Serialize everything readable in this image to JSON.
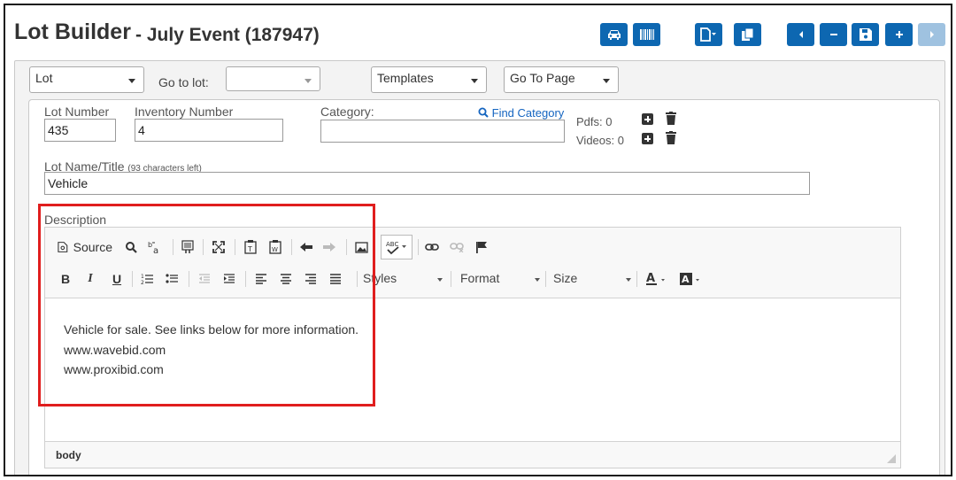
{
  "header": {
    "title": "Lot Builder",
    "subtitle": "- July Event (187947)"
  },
  "top_toolbar": {
    "buttons": [
      "car-icon",
      "barcode-icon",
      "file-dropdown-icon",
      "copy-icon",
      "prev-icon",
      "minus-icon",
      "save-icon",
      "plus-icon",
      "next-icon"
    ]
  },
  "nav": {
    "lot_select": "Lot",
    "go_to_lot_label": "Go to lot:",
    "go_to_lot_value": "",
    "templates_select": "Templates",
    "go_to_page_select": "Go To Page"
  },
  "form": {
    "lot_number_label": "Lot Number",
    "lot_number_value": "435",
    "inventory_number_label": "Inventory Number",
    "inventory_number_value": "4",
    "category_label": "Category:",
    "category_value": "",
    "find_category_label": "Find Category",
    "pdfs_label": "Pdfs: 0",
    "videos_label": "Videos: 0",
    "lot_name_label": "Lot Name/Title",
    "lot_name_hint": "(93 characters left)",
    "lot_name_value": "Vehicle",
    "description_label": "Description"
  },
  "editor": {
    "source_label": "Source",
    "styles_label": "Styles",
    "format_label": "Format",
    "size_label": "Size",
    "content_lines": [
      "Vehicle for sale. See links below for more information.",
      "www.wavebid.com",
      "www.proxibid.com"
    ],
    "status_path": "body"
  },
  "colors": {
    "accent": "#0d67b1",
    "highlight": "#e01e1e"
  }
}
